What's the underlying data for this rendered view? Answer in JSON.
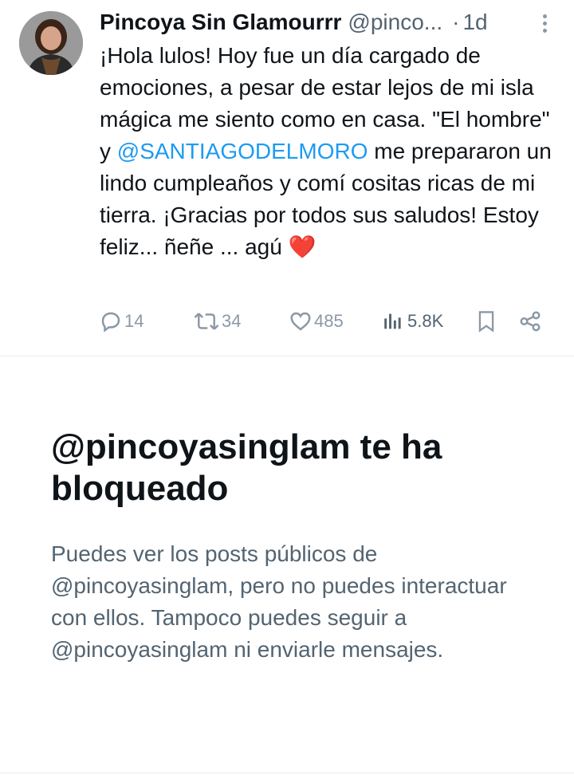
{
  "tweet": {
    "author_name": "Pincoya Sin Glamourrr",
    "author_handle": "@pinco...",
    "separator": "·",
    "time": "1d",
    "text_before": "¡Hola lulos! Hoy fue un día cargado de emociones, a pesar de estar lejos de mi isla mágica me siento como en casa. \"El hombre\" y ",
    "mention": "@SANTIAGODELMORO",
    "text_after": " me prepararon un lindo cumpleaños y comí cositas ricas de mi tierra. ¡Gracias por todos sus saludos! Estoy feliz... ñeñe ... agú ",
    "emoji": "❤️",
    "replies": "14",
    "retweets": "34",
    "likes": "485",
    "views": "5.8K"
  },
  "blocked": {
    "title": "@pincoyasinglam te ha bloqueado",
    "description": "Puedes ver los posts públicos de @pincoyasinglam, pero no puedes interactuar con ellos. Tampoco puedes seguir a @pincoyasinglam ni enviarle mensajes."
  },
  "colors": {
    "text": "#0f1419",
    "secondary": "#536471",
    "link": "#1d9bf0",
    "heart": "#e0245e",
    "icon": "#8b98a5"
  }
}
